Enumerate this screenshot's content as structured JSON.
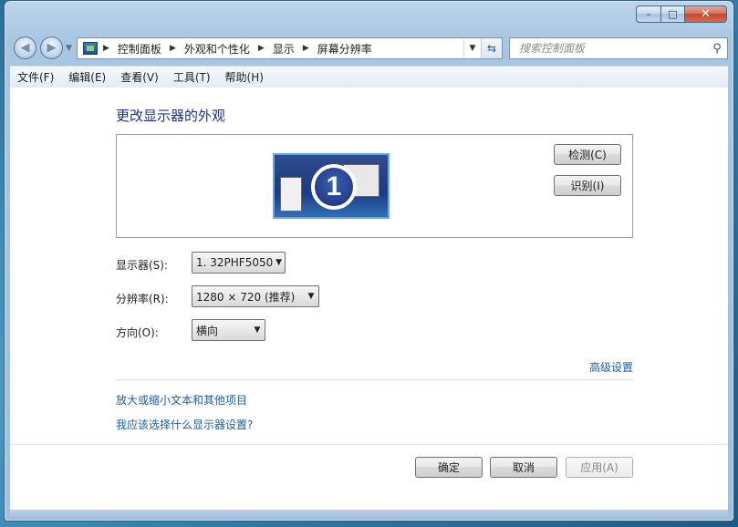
{
  "window": {
    "caption": {
      "minimize": "–",
      "maximize": "□",
      "close": "✕"
    }
  },
  "nav": {
    "back": "◀",
    "forward": "▶",
    "breadcrumbs": [
      "控制面板",
      "外观和个性化",
      "显示",
      "屏幕分辨率"
    ],
    "search_placeholder": "搜索控制面板"
  },
  "menu": [
    "文件(F)",
    "编辑(E)",
    "查看(V)",
    "工具(T)",
    "帮助(H)"
  ],
  "main": {
    "title": "更改显示器的外观",
    "monitor_number": "1",
    "detect_label": "检测(C)",
    "identify_label": "识别(I)",
    "display_label": "显示器(S):",
    "display_value": "1. 32PHF5050",
    "resolution_label": "分辨率(R):",
    "resolution_value": "1280 × 720 (推荐)",
    "orientation_label": "方向(O):",
    "orientation_value": "横向",
    "advanced_link": "高级设置",
    "text_size_link": "放大或缩小文本和其他项目",
    "which_settings_link": "我应该选择什么显示器设置?"
  },
  "footer": {
    "ok_label": "确定",
    "cancel_label": "取消",
    "apply_label": "应用(A)"
  },
  "colors": {
    "title": "#1e3287",
    "link": "#1e5ea8",
    "desktop": "#2f7aa6"
  }
}
